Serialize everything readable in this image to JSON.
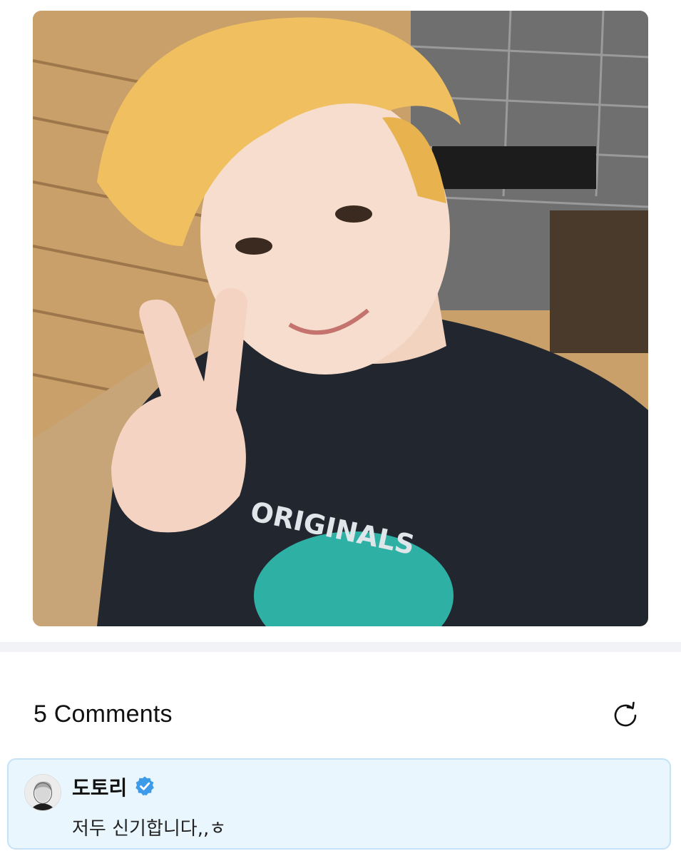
{
  "post": {
    "image": {
      "icon": "selfie-photo",
      "description_free": true
    }
  },
  "comments": {
    "count_label": "5 Comments",
    "refresh_icon": "refresh-icon"
  },
  "highlighted_comment": {
    "author": "도토리",
    "verified_icon": "verified-badge-icon",
    "text": "저두 신기합니다,,ㅎ",
    "accent_color": "#3d9be9",
    "card_background": "#eaf6fe",
    "card_border": "#c5e2f6"
  }
}
